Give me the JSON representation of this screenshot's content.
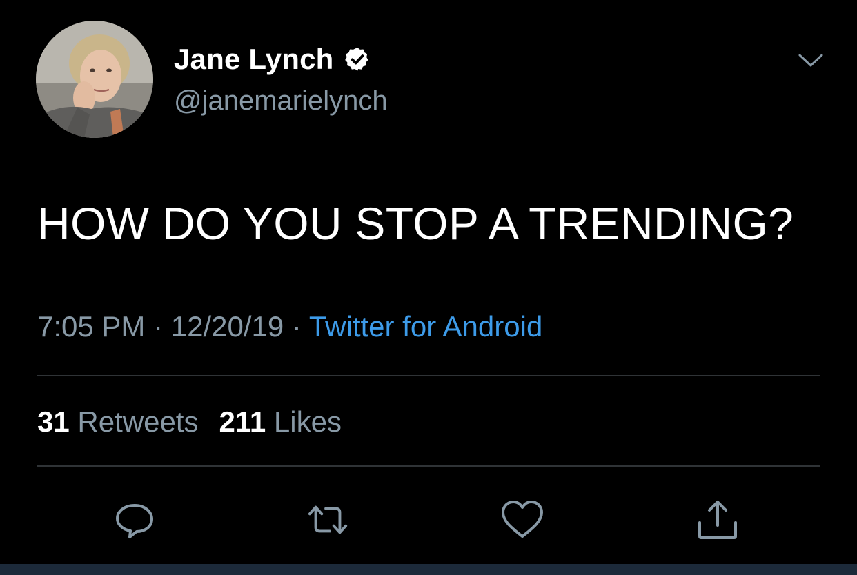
{
  "author": {
    "display_name": "Jane Lynch",
    "handle": "@janemarielynch",
    "verified": true
  },
  "tweet": {
    "text": "HOW DO YOU STOP A TRENDING?",
    "time": "7:05 PM",
    "separator_1": " · ",
    "date": "12/20/19",
    "separator_2": " · ",
    "source": "Twitter for Android"
  },
  "stats": {
    "retweets_count": "31",
    "retweets_label": "Retweets",
    "likes_count": "211",
    "likes_label": "Likes"
  },
  "icons": {
    "menu": "chevron-down-icon",
    "reply": "reply-icon",
    "retweet": "retweet-icon",
    "like": "heart-icon",
    "share": "share-icon",
    "verified": "verified-badge-icon"
  },
  "colors": {
    "background": "#000000",
    "text_primary": "#ffffff",
    "text_secondary": "#8899a6",
    "link": "#3d9be9",
    "divider": "#2f3336"
  }
}
